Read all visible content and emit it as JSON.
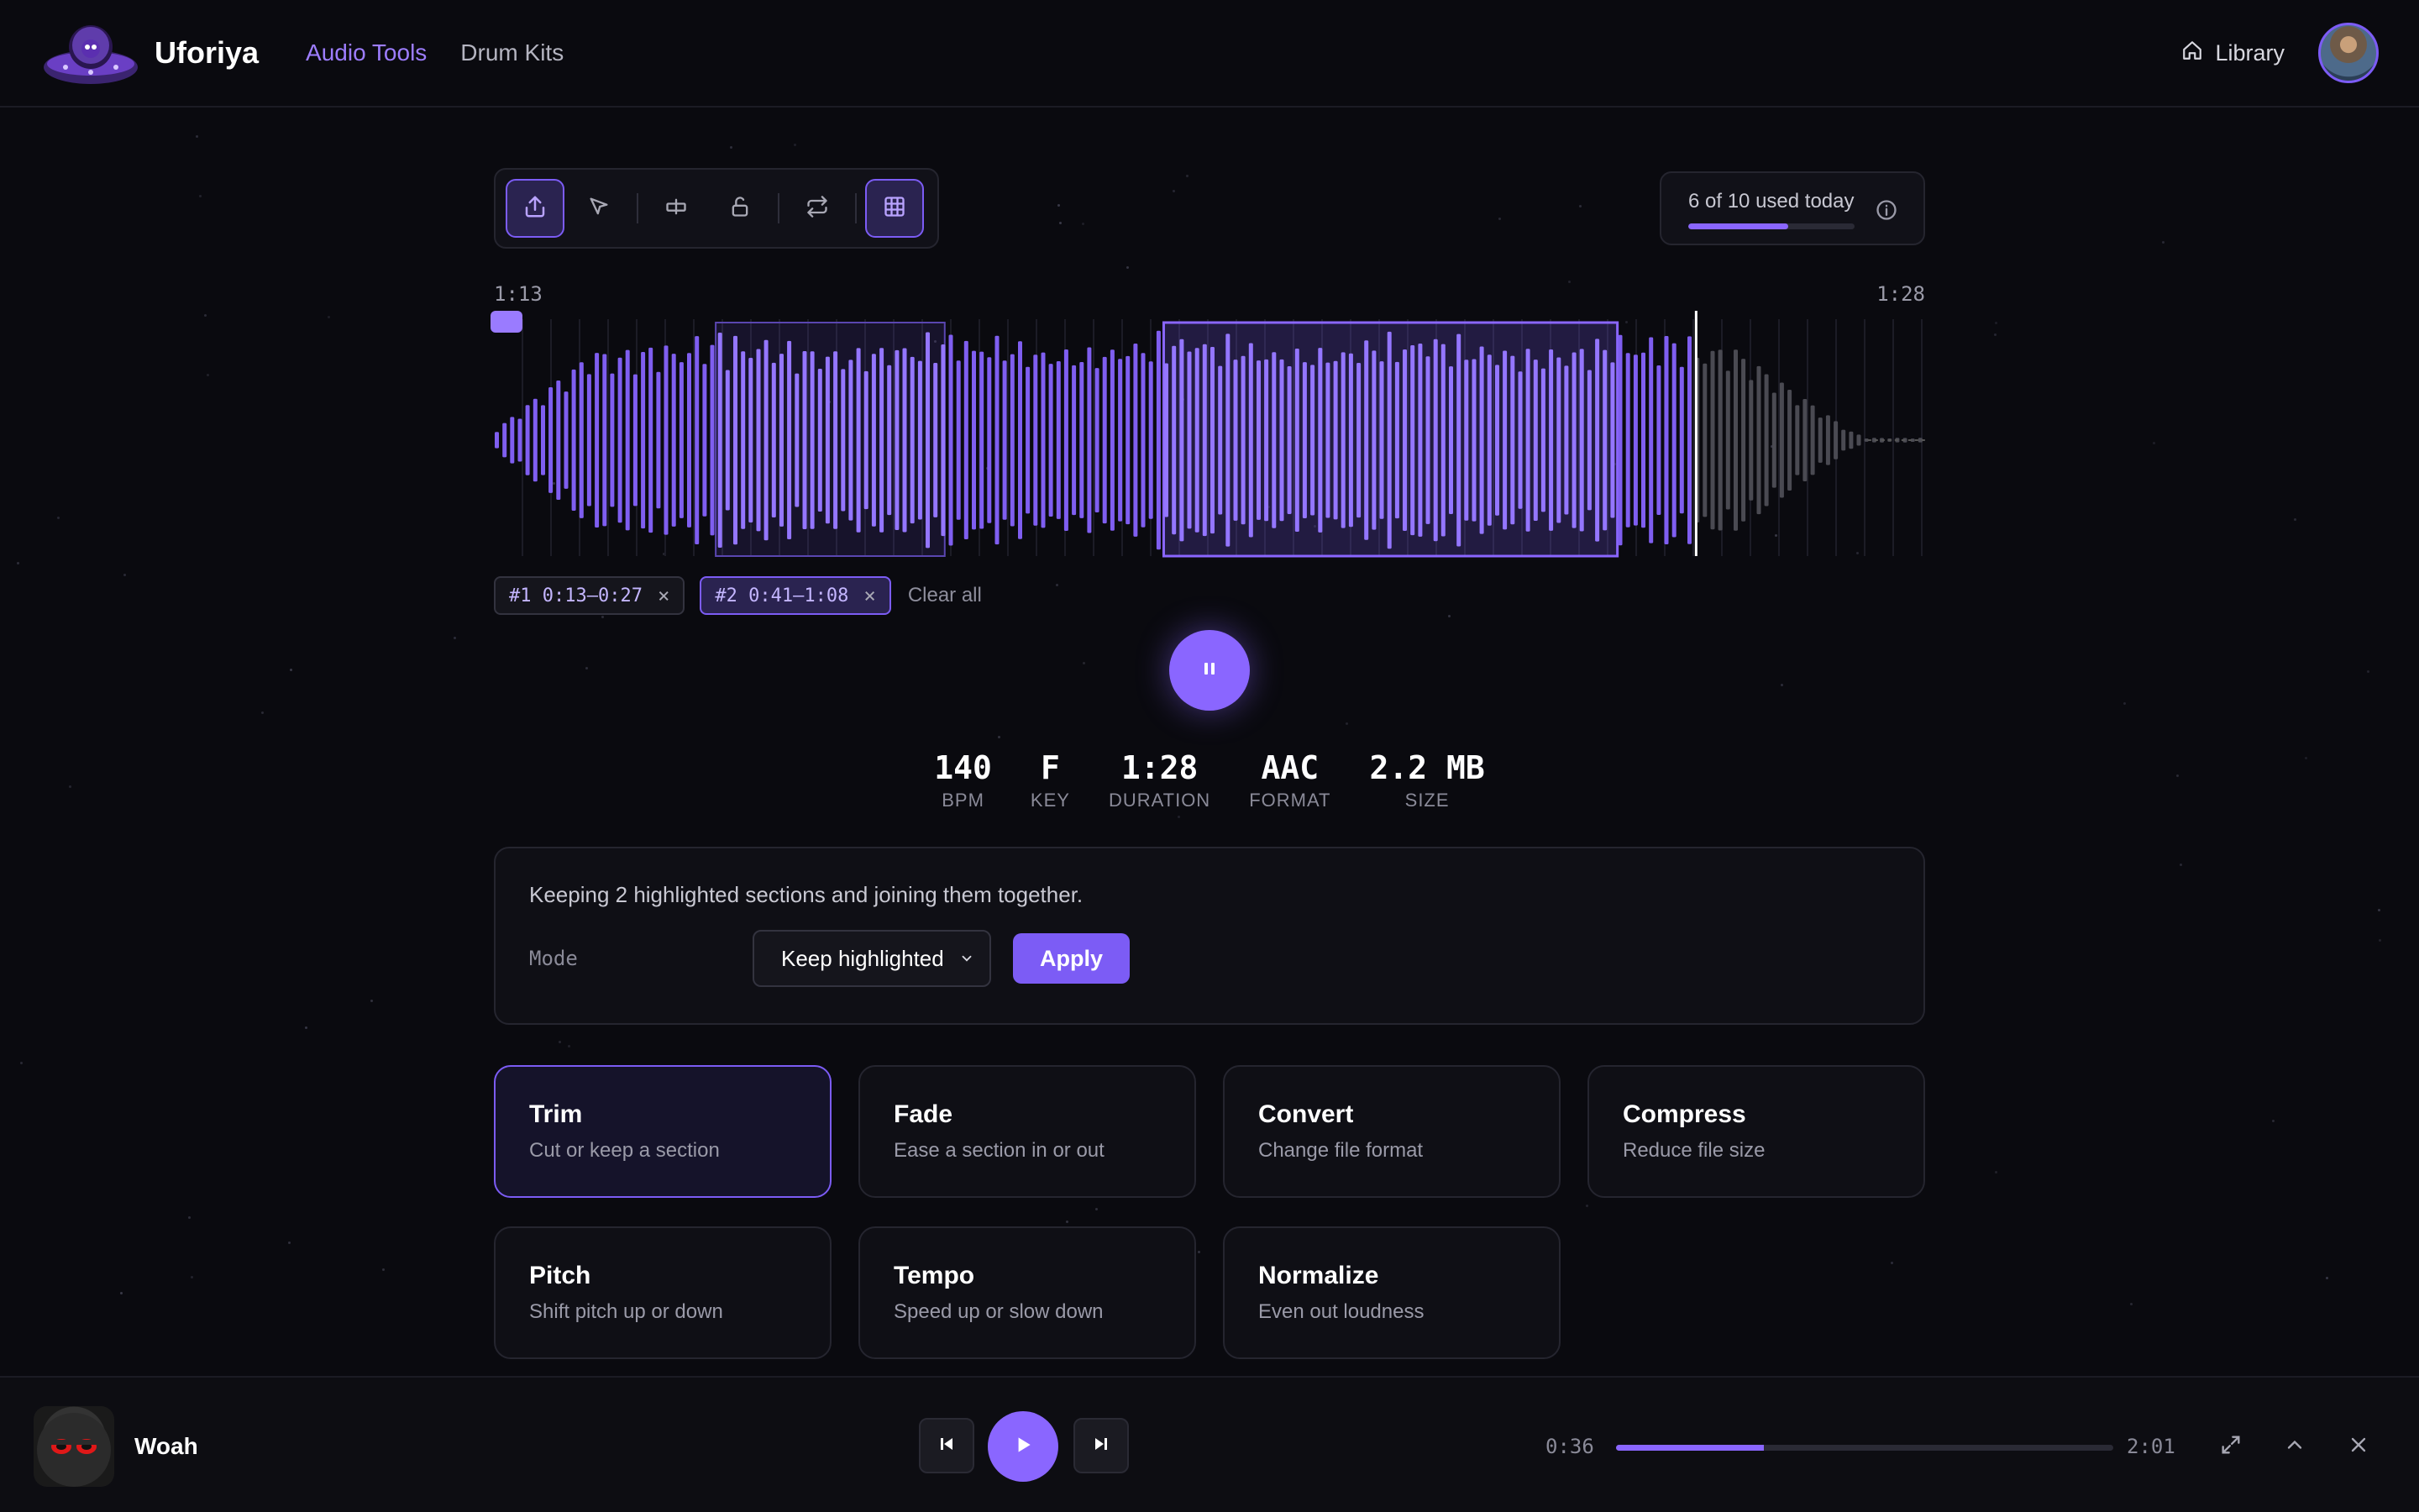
{
  "app": {
    "name": "Uforiya"
  },
  "nav": {
    "items": [
      {
        "label": "Audio Tools",
        "active": true
      },
      {
        "label": "Drum Kits",
        "active": false
      }
    ]
  },
  "header": {
    "library_label": "Library"
  },
  "toolbar": {
    "tools": [
      {
        "name": "upload-icon",
        "active": true
      },
      {
        "name": "cursor-icon",
        "active": false
      },
      {
        "name": "split-icon",
        "active": false
      },
      {
        "name": "unlock-icon",
        "active": false
      },
      {
        "name": "loop-icon",
        "active": false
      },
      {
        "name": "grid-icon",
        "active": true
      }
    ]
  },
  "usage": {
    "text": "6 of 10 used today",
    "used": 6,
    "limit": 10
  },
  "waveform": {
    "start_time": "1:13",
    "end_time": "1:28",
    "played_fraction": 0.84
  },
  "selections": [
    {
      "label": "#1 0:13–0:27",
      "active": false
    },
    {
      "label": "#2 0:41–1:08",
      "active": true
    }
  ],
  "selections_clear": "Clear all",
  "stats": [
    {
      "value": "140",
      "label": "BPM"
    },
    {
      "value": "F",
      "label": "KEY"
    },
    {
      "value": "1:28",
      "label": "DURATION"
    },
    {
      "value": "AAC",
      "label": "FORMAT"
    },
    {
      "value": "2.2 MB",
      "label": "SIZE"
    }
  ],
  "panel": {
    "description": "Keeping 2 highlighted sections and joining them together.",
    "mode_label": "Mode",
    "mode_value": "Keep highlighted",
    "apply_label": "Apply"
  },
  "tools": [
    {
      "title": "Trim",
      "desc": "Cut or keep a section",
      "active": true
    },
    {
      "title": "Fade",
      "desc": "Ease a section in or out",
      "active": false
    },
    {
      "title": "Convert",
      "desc": "Change file format",
      "active": false
    },
    {
      "title": "Compress",
      "desc": "Reduce file size",
      "active": false
    },
    {
      "title": "Pitch",
      "desc": "Shift pitch up or down",
      "active": false
    },
    {
      "title": "Tempo",
      "desc": "Speed up or slow down",
      "active": false
    },
    {
      "title": "Normalize",
      "desc": "Even out loudness",
      "active": false
    }
  ],
  "player": {
    "track": "Woah",
    "current_time": "0:36",
    "total_time": "2:01",
    "progress": 0.297
  },
  "colors": {
    "accent": "#8a66ff",
    "background": "#0a0a0f",
    "card": "#0f0f15"
  }
}
